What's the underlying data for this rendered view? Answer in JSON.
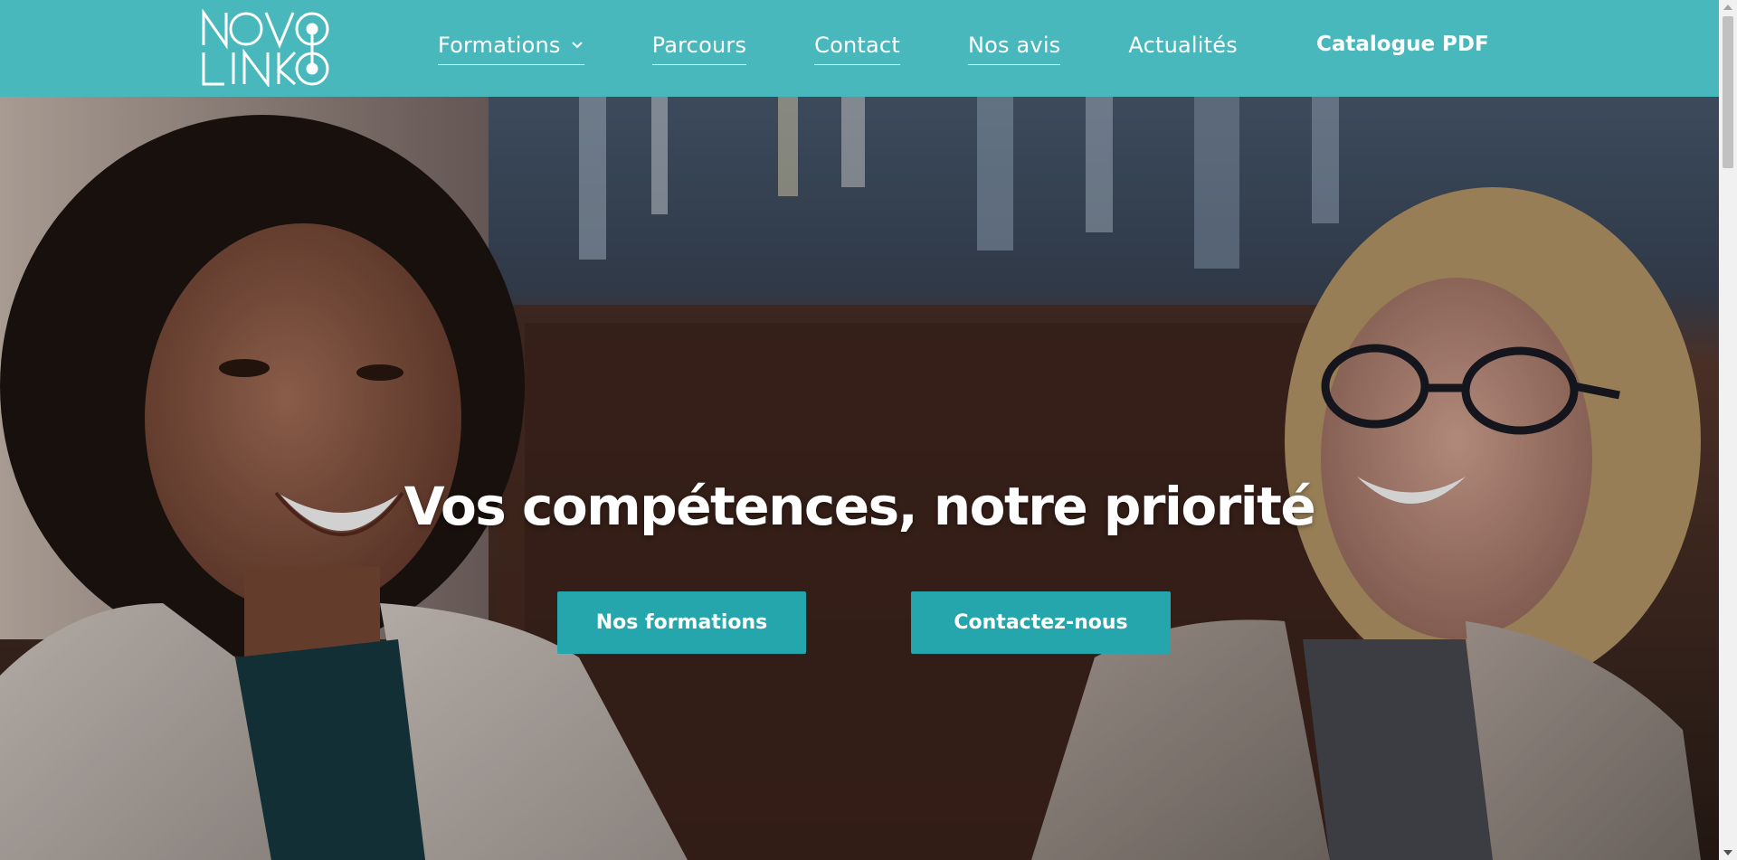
{
  "logo": {
    "line1": "NOVO",
    "line2": "LINKO",
    "icon": "novolinko-logo-icon"
  },
  "nav": {
    "items": [
      {
        "label": "Formations",
        "has_dropdown": true,
        "icon": "chevron-down-icon"
      },
      {
        "label": "Parcours"
      },
      {
        "label": "Contact"
      },
      {
        "label": "Nos avis"
      },
      {
        "label": "Actualités"
      }
    ],
    "catalogue_label": "Catalogue PDF"
  },
  "hero": {
    "title": "Vos compétences, notre priorité",
    "buttons": {
      "formations": "Nos formations",
      "contact": "Contactez-nous"
    }
  },
  "colors": {
    "header_bg": "#49b8bd",
    "button_bg": "#25a6ad",
    "text": "#ffffff"
  }
}
